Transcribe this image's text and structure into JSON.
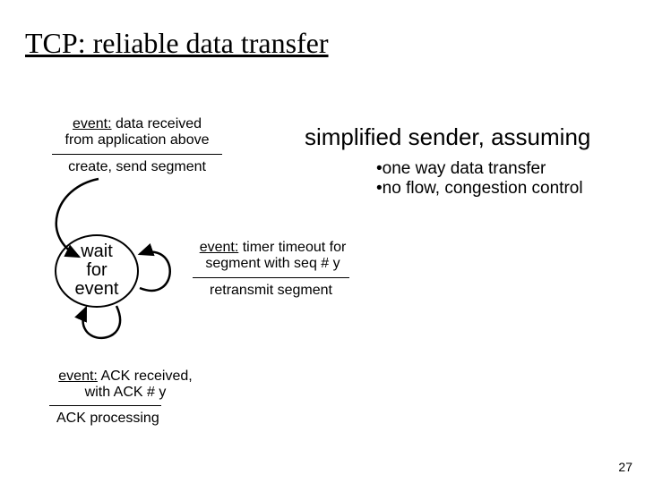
{
  "title": "TCP: reliable data transfer",
  "top_event": {
    "prefix": "event:",
    "line1_rest": " data received",
    "line2": "from application above",
    "action": "create, send segment"
  },
  "right": {
    "headline": "simplified sender, assuming",
    "bullet1": "•one way data transfer",
    "bullet2": "•no flow, congestion control"
  },
  "state": {
    "l1": "wait",
    "l2": "for",
    "l3": "event"
  },
  "timeout_event": {
    "prefix": "event:",
    "line1_rest": " timer timeout for",
    "line2": "segment with seq # y",
    "action": "retransmit segment"
  },
  "ack_event": {
    "prefix": "event:",
    "line1_rest": " ACK received,",
    "line2": "with ACK # y",
    "action": "ACK processing"
  },
  "page_number": "27"
}
